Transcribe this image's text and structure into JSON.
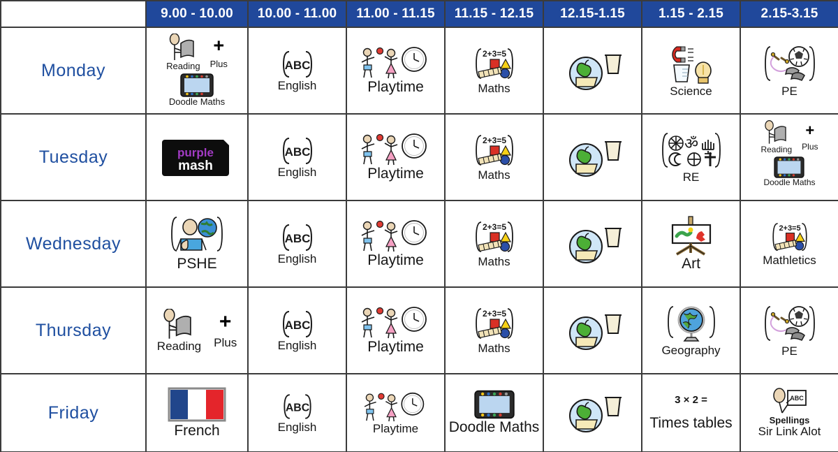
{
  "header": {
    "corner_label": "",
    "times": [
      "9.00 - 10.00",
      "10.00 - 11.00",
      "11.00 - 11.15",
      "11.15 - 12.15",
      "12.15-1.15",
      "1.15 - 2.15",
      "2.15-3.15"
    ],
    "background_color": "#20489B",
    "text_color": "#FFFFFF"
  },
  "day_label_color": "#1F4FA0",
  "days": [
    {
      "name": "Monday"
    },
    {
      "name": "Tuesday"
    },
    {
      "name": "Wednesday"
    },
    {
      "name": "Thursday"
    },
    {
      "name": "Friday"
    }
  ],
  "labels": {
    "reading": "Reading",
    "plus": "Plus",
    "plus_sign": "+",
    "doodle_maths": "Doodle Maths",
    "english": "English",
    "english_icon_text": "ABC",
    "playtime": "Playtime",
    "maths": "Maths",
    "maths_icon_text": "2+3=5",
    "lunch": "",
    "science": "Science",
    "pe": "PE",
    "purple_mash_top": "purple",
    "purple_mash_bottom": "mash",
    "re": "RE",
    "pshe": "PSHE",
    "art": "Art",
    "mathletics": "Mathletics",
    "geography": "Geography",
    "french": "French",
    "times_tables": "Times tables",
    "times_tables_sum": "3 × 2 =",
    "spellings": "Spellings",
    "spellings_scheme": "Sir Link Alot",
    "spellings_icon_text": "ABC"
  },
  "schedule": {
    "monday": [
      "Reading Plus / Doodle Maths",
      "English",
      "Playtime",
      "Maths",
      "Lunch",
      "Science",
      "PE"
    ],
    "tuesday": [
      "purple mash",
      "English",
      "Playtime",
      "Maths",
      "Lunch",
      "RE",
      "Reading Plus / Doodle Maths"
    ],
    "wednesday": [
      "PSHE",
      "English",
      "Playtime",
      "Maths",
      "Lunch",
      "Art",
      "Mathletics"
    ],
    "thursday": [
      "Reading Plus",
      "English",
      "Playtime",
      "Maths",
      "Lunch",
      "Geography",
      "PE"
    ],
    "friday": [
      "French",
      "English",
      "Playtime",
      "Doodle Maths",
      "Lunch",
      "Times tables",
      "Spellings Sir Link Alot"
    ]
  }
}
